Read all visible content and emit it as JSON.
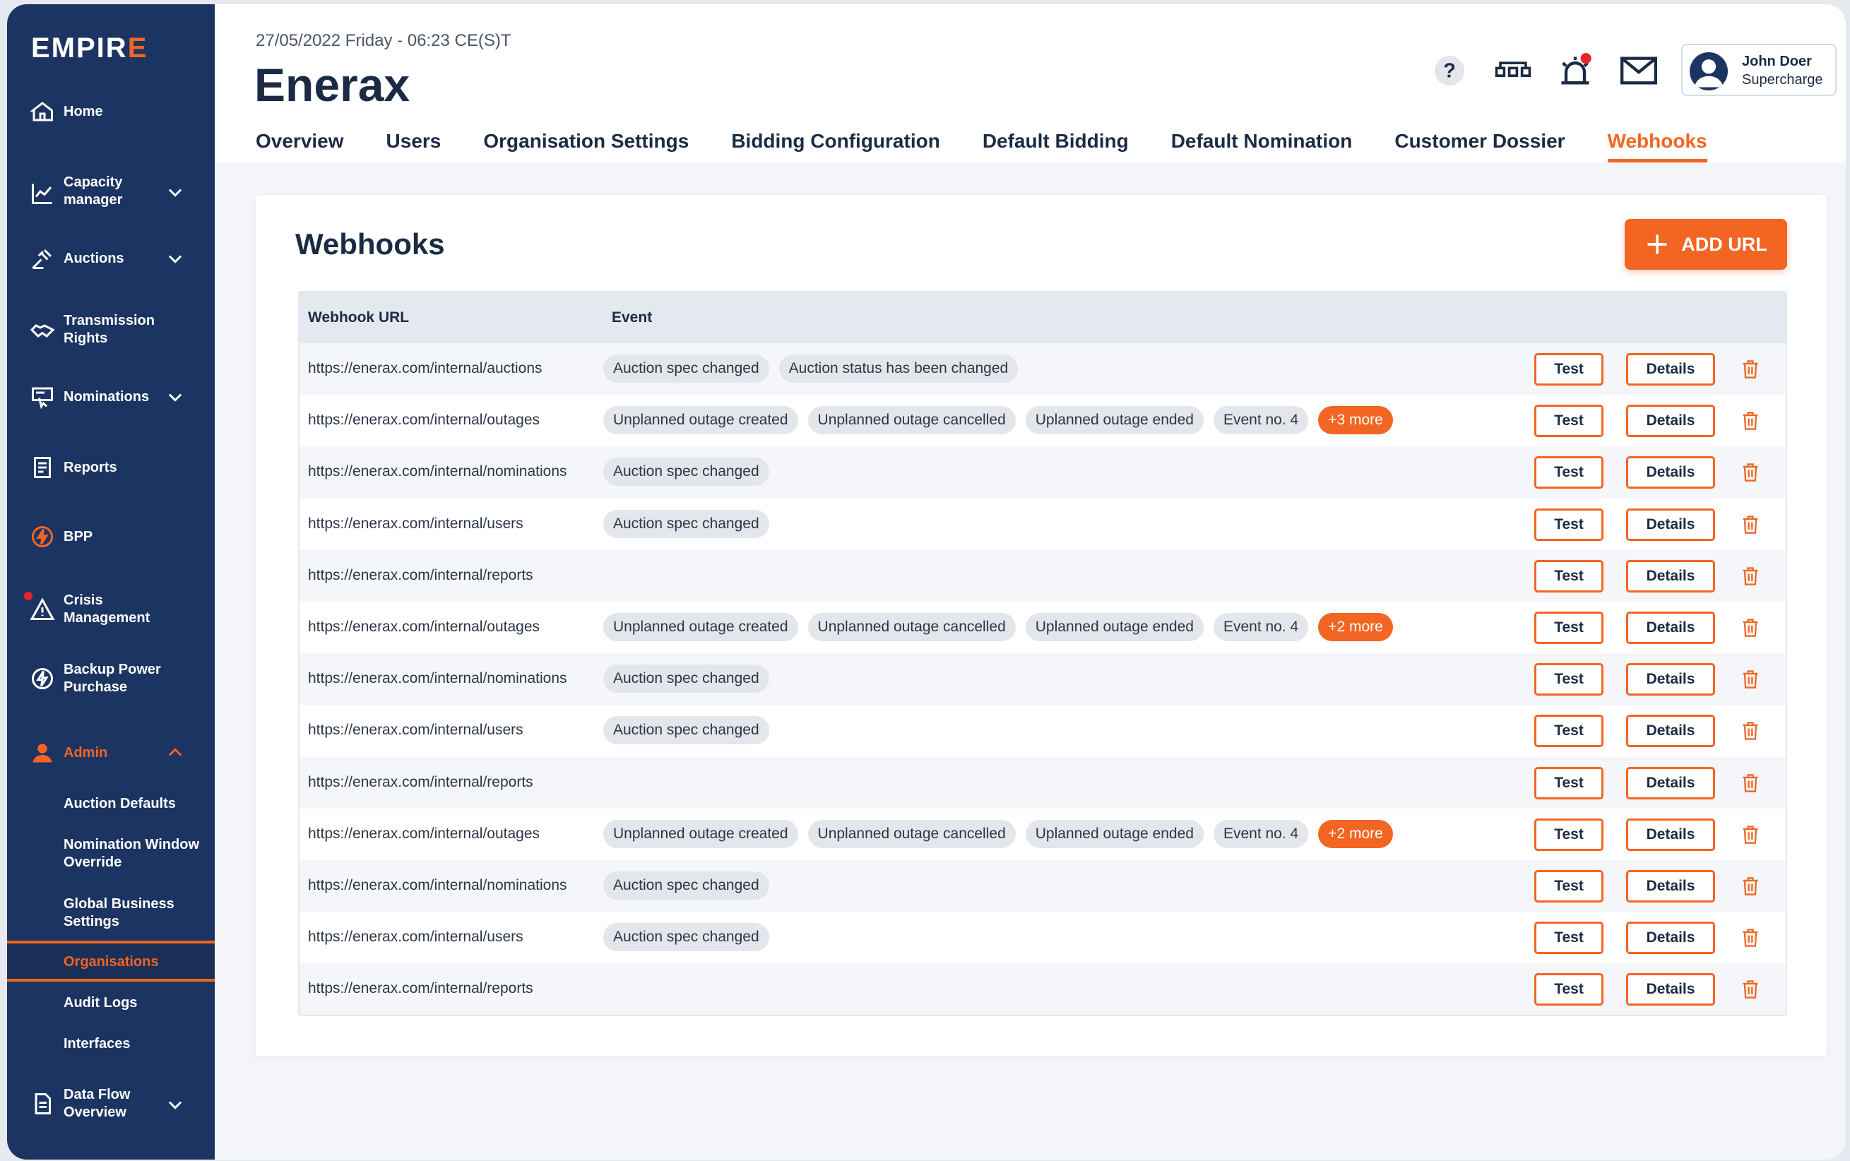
{
  "brand": {
    "logo_main": "EMPIR",
    "logo_accent": "E"
  },
  "sidebar": {
    "items": [
      {
        "label": "Home",
        "icon": "home-icon"
      },
      {
        "label": "Capacity manager",
        "icon": "chart-line-icon",
        "expandable": true
      },
      {
        "label": "Auctions",
        "icon": "gavel-icon",
        "expandable": true
      },
      {
        "label": "Transmission Rights",
        "icon": "handshake-icon"
      },
      {
        "label": "Nominations",
        "icon": "monitor-pointer-icon",
        "expandable": true
      },
      {
        "label": "Reports",
        "icon": "report-icon"
      },
      {
        "label": "BPP",
        "icon": "bolt-badge-icon"
      },
      {
        "label": "Crisis Management",
        "icon": "warning-triangle-icon"
      },
      {
        "label": "Backup Power Purchase",
        "icon": "power-bolt-icon"
      },
      {
        "label": "Admin",
        "icon": "user-icon",
        "expanded": true
      },
      {
        "label": "Data Flow Overview",
        "icon": "document-icon",
        "expandable": true
      }
    ],
    "admin_sub": [
      {
        "label": "Auction Defaults"
      },
      {
        "label": "Nomination Window Override"
      },
      {
        "label": "Global Business Settings"
      },
      {
        "label": "Organisations",
        "active": true
      },
      {
        "label": "Audit Logs"
      },
      {
        "label": "Interfaces"
      }
    ]
  },
  "header": {
    "datetime": "27/05/2022 Friday - 06:23 CE(S)T",
    "title": "Enerax",
    "user": {
      "name": "John Doer",
      "role": "Supercharge"
    },
    "icons": [
      "help-icon",
      "network-icon",
      "alarm-icon",
      "mail-icon"
    ]
  },
  "tabs": [
    {
      "label": "Overview"
    },
    {
      "label": "Users"
    },
    {
      "label": "Organisation Settings"
    },
    {
      "label": "Bidding Configuration"
    },
    {
      "label": "Default Bidding"
    },
    {
      "label": "Default Nomination"
    },
    {
      "label": "Customer Dossier"
    },
    {
      "label": "Webhooks",
      "active": true
    }
  ],
  "page": {
    "title": "Webhooks",
    "add_label": "ADD URL",
    "columns": {
      "url": "Webhook URL",
      "event": "Event"
    },
    "test_label": "Test",
    "details_label": "Details"
  },
  "rows": [
    {
      "url": "https://enerax.com/internal/auctions",
      "events": [
        "Auction spec changed",
        "Auction status has been changed"
      ],
      "more": ""
    },
    {
      "url": "https://enerax.com/internal/outages",
      "events": [
        "Unplanned outage created",
        "Unplanned outage cancelled",
        "Uplanned outage ended",
        "Event no. 4"
      ],
      "more": "+3 more"
    },
    {
      "url": "https://enerax.com/internal/nominations",
      "events": [
        "Auction spec changed"
      ],
      "more": ""
    },
    {
      "url": "https://enerax.com/internal/users",
      "events": [
        "Auction spec changed"
      ],
      "more": ""
    },
    {
      "url": "https://enerax.com/internal/reports",
      "events": [],
      "more": ""
    },
    {
      "url": "https://enerax.com/internal/outages",
      "events": [
        "Unplanned outage created",
        "Unplanned outage cancelled",
        "Uplanned outage ended",
        "Event no. 4"
      ],
      "more": "+2 more"
    },
    {
      "url": "https://enerax.com/internal/nominations",
      "events": [
        "Auction spec changed"
      ],
      "more": ""
    },
    {
      "url": "https://enerax.com/internal/users",
      "events": [
        "Auction spec changed"
      ],
      "more": ""
    },
    {
      "url": "https://enerax.com/internal/reports",
      "events": [],
      "more": ""
    },
    {
      "url": "https://enerax.com/internal/outages",
      "events": [
        "Unplanned outage created",
        "Unplanned outage cancelled",
        "Uplanned outage ended",
        "Event no. 4"
      ],
      "more": "+2 more"
    },
    {
      "url": "https://enerax.com/internal/nominations",
      "events": [
        "Auction spec changed"
      ],
      "more": ""
    },
    {
      "url": "https://enerax.com/internal/users",
      "events": [
        "Auction spec changed"
      ],
      "more": ""
    },
    {
      "url": "https://enerax.com/internal/reports",
      "events": [],
      "more": ""
    }
  ],
  "colors": {
    "accent": "#f26522",
    "sidebar": "#1c3461",
    "chip": "#e3e6eb"
  }
}
